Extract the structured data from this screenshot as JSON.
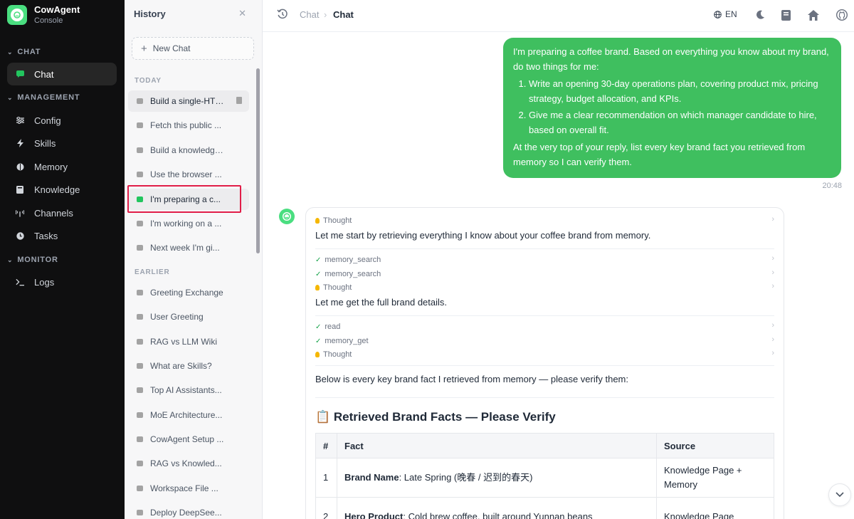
{
  "brand": {
    "name": "CowAgent",
    "sub": "Console"
  },
  "sidebar": {
    "sections": {
      "chat": "CHAT",
      "management": "MANAGEMENT",
      "monitor": "MONITOR"
    },
    "items": [
      {
        "label": "Chat",
        "icon": "chat-bubble-icon"
      },
      {
        "label": "Config",
        "icon": "sliders-icon"
      },
      {
        "label": "Skills",
        "icon": "lightning-icon"
      },
      {
        "label": "Memory",
        "icon": "brain-icon"
      },
      {
        "label": "Knowledge",
        "icon": "book-icon"
      },
      {
        "label": "Channels",
        "icon": "broadcast-icon"
      },
      {
        "label": "Tasks",
        "icon": "clock-icon"
      },
      {
        "label": "Logs",
        "icon": "terminal-icon"
      }
    ]
  },
  "history": {
    "title": "History",
    "new_chat": "New Chat",
    "today_label": "TODAY",
    "earlier_label": "EARLIER",
    "today": [
      "Build a single-HTML...",
      "Fetch this public ...",
      "Build a knowledge ...",
      "Use the browser ...",
      "I'm preparing a c...",
      "I'm working on a ...",
      "Next week I'm gi..."
    ],
    "earlier": [
      "Greeting Exchange",
      "User Greeting",
      "RAG vs LLM Wiki",
      "What are Skills?",
      "Top AI Assistants...",
      "MoE Architecture...",
      "CowAgent Setup ...",
      "RAG vs Knowled...",
      "Workspace File ...",
      "Deploy DeepSee..."
    ]
  },
  "topbar": {
    "crumb1": "Chat",
    "crumb_sep": "›",
    "crumb2": "Chat",
    "lang": "EN"
  },
  "user_msg": {
    "intro": "I'm preparing a coffee brand. Based on everything you know about my brand, do two things for me:",
    "items": [
      "Write an opening 30-day operations plan, covering product mix, pricing strategy, budget allocation, and KPIs.",
      "Give me a clear recommendation on which manager candidate to hire, based on overall fit."
    ],
    "outro": "At the very top of your reply, list every key brand fact you retrieved from memory so I can verify them.",
    "time": "20:48"
  },
  "assistant": {
    "thought1": "Thought",
    "text1": "Let me start by retrieving everything I know about your coffee brand from memory.",
    "tool1": "memory_search",
    "tool2": "memory_search",
    "thought2": "Thought",
    "text2": "Let me get the full brand details.",
    "tool3": "read",
    "tool4": "memory_get",
    "thought3": "Thought",
    "text3": "Below is every key brand fact I retrieved from memory — please verify them:",
    "facts_title": "📋 Retrieved Brand Facts — Please Verify",
    "table": {
      "headers": [
        "#",
        "Fact",
        "Source"
      ],
      "rows": [
        {
          "num": "1",
          "key": "Brand Name",
          "val": ": Late Spring (晚春 / 迟到的春天)",
          "src": "Knowledge Page + Memory"
        },
        {
          "num": "2",
          "key": "Hero Product",
          "val": ": Cold brew coffee, built around Yunnan beans",
          "src": "Knowledge Page"
        }
      ]
    }
  }
}
